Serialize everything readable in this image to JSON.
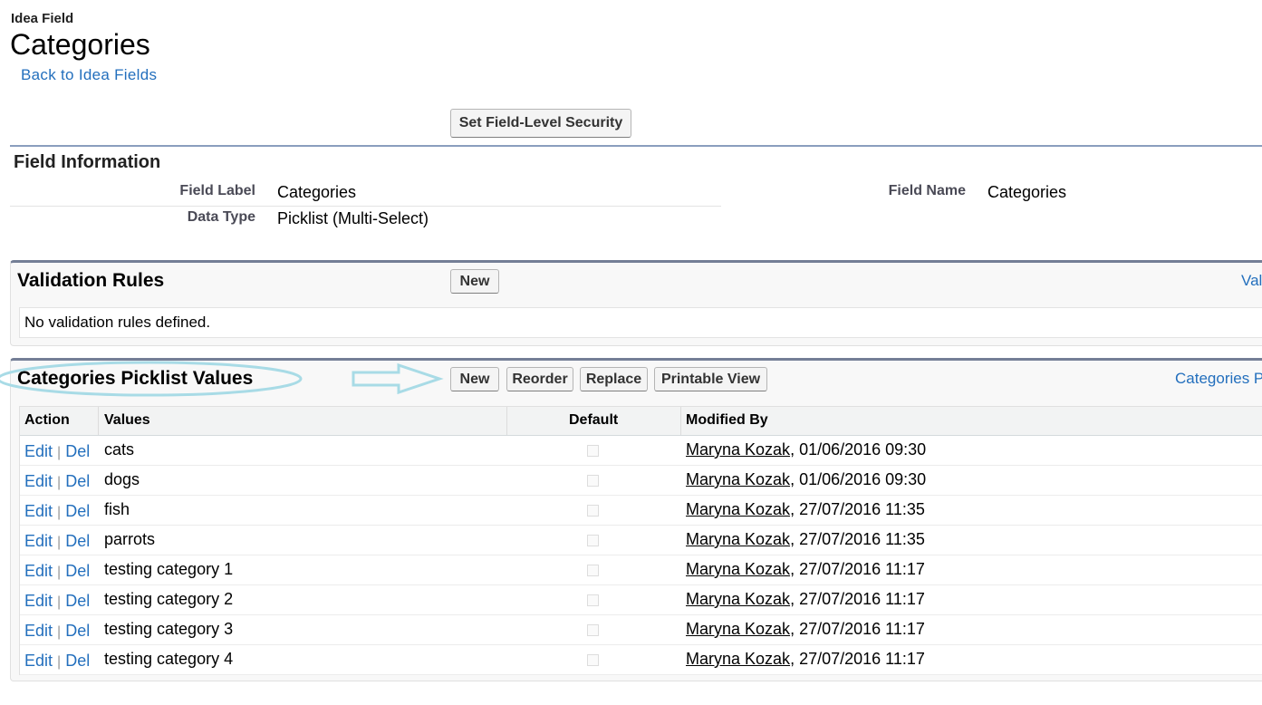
{
  "header": {
    "breadcrumb": "Idea Field",
    "title": "Categories",
    "back_link": "Back to Idea Fields"
  },
  "toolbar": {
    "field_level_security": "Set Field-Level Security"
  },
  "field_info": {
    "title": "Field Information",
    "field_label_label": "Field Label",
    "field_label_value": "Categories",
    "data_type_label": "Data Type",
    "data_type_value": "Picklist (Multi-Select)",
    "field_name_label": "Field Name",
    "field_name_value": "Categories"
  },
  "validation_rules": {
    "title": "Validation Rules",
    "new_label": "New",
    "help_link": "Val",
    "empty_text": "No validation rules defined."
  },
  "picklist": {
    "title": "Categories Picklist Values",
    "buttons": {
      "new": "New",
      "reorder": "Reorder",
      "replace": "Replace",
      "printable": "Printable View"
    },
    "help_link": "Categories P",
    "columns": {
      "action": "Action",
      "values": "Values",
      "default": "Default",
      "modified_by": "Modified By"
    },
    "edit_label": "Edit",
    "del_label": "Del",
    "separator": "|",
    "rows": [
      {
        "value": "cats",
        "default": false,
        "user": "Maryna Kozak",
        "date": ", 01/06/2016 09:30"
      },
      {
        "value": "dogs",
        "default": false,
        "user": "Maryna Kozak",
        "date": ", 01/06/2016 09:30"
      },
      {
        "value": "fish",
        "default": false,
        "user": "Maryna Kozak",
        "date": ", 27/07/2016 11:35"
      },
      {
        "value": "parrots",
        "default": false,
        "user": "Maryna Kozak",
        "date": ", 27/07/2016 11:35"
      },
      {
        "value": "testing category 1",
        "default": false,
        "user": "Maryna Kozak",
        "date": ", 27/07/2016 11:17"
      },
      {
        "value": "testing category 2",
        "default": false,
        "user": "Maryna Kozak",
        "date": ", 27/07/2016 11:17"
      },
      {
        "value": "testing category 3",
        "default": false,
        "user": "Maryna Kozak",
        "date": ", 27/07/2016 11:17"
      },
      {
        "value": "testing category 4",
        "default": false,
        "user": "Maryna Kozak",
        "date": ", 27/07/2016 11:17"
      }
    ]
  },
  "colors": {
    "link": "#236fbd",
    "annotation": "#a8dbe6",
    "section_border": "#747e96"
  }
}
